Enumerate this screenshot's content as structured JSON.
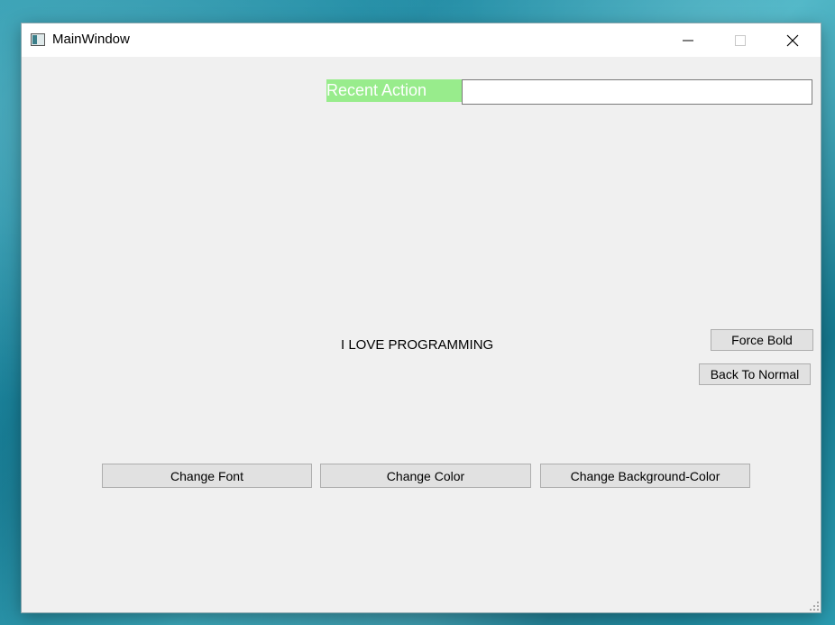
{
  "window": {
    "title": "MainWindow",
    "icon": "app-window-icon"
  },
  "caption_buttons": {
    "minimize_icon": "minimize-icon",
    "maximize_icon": "maximize-icon",
    "close_icon": "close-icon"
  },
  "recent_action": {
    "label": "Recent Action",
    "label_background": "#98ec8c",
    "label_color": "#ffffff",
    "input_value": ""
  },
  "center_text": "I LOVE PROGRAMMING",
  "buttons": {
    "force_bold": "Force Bold",
    "back_to_normal": "Back To Normal",
    "change_font": "Change Font",
    "change_color": "Change Color",
    "change_background_color": "Change Background-Color"
  },
  "colors": {
    "window_background": "#f0f0f0",
    "button_face": "#e1e1e1",
    "button_border": "#adadad"
  }
}
